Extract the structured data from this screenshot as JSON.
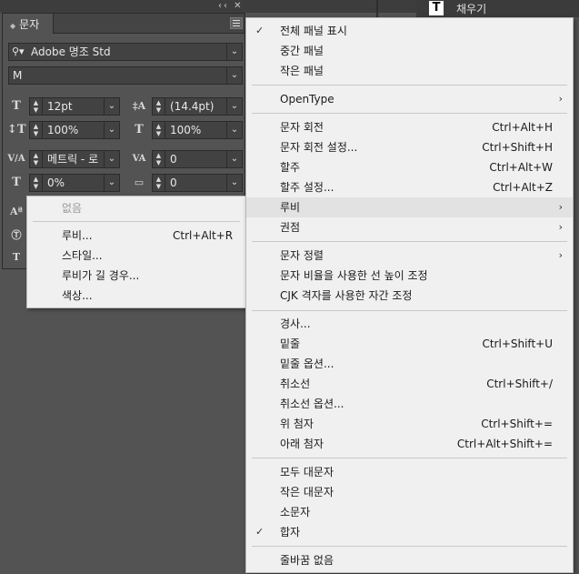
{
  "topbar": {
    "grip": "‹‹ ✕"
  },
  "top_right_panel": {
    "icon_letter": "T",
    "label": "채우기"
  },
  "char_panel": {
    "tab_label": "문자",
    "font_family": "Adobe 명조 Std",
    "font_style": "M",
    "font_size": "12pt",
    "leading": "(14.4pt)",
    "vertical_scale": "100%",
    "horizontal_scale": "100%",
    "kerning": "메트릭 - 로",
    "tracking": "0",
    "tsume": "0%",
    "grid_spacing": "0"
  },
  "ruby_menu": {
    "items": [
      {
        "label": "없음",
        "shortcut": ""
      },
      {
        "label": "루비...",
        "shortcut": "Ctrl+Alt+R"
      },
      {
        "label": "스타일...",
        "shortcut": ""
      },
      {
        "label": "루비가 길 경우...",
        "shortcut": ""
      },
      {
        "label": "색상...",
        "shortcut": ""
      }
    ]
  },
  "main_menu": {
    "items": [
      {
        "label": "전체 패널 표시",
        "shortcut": "",
        "check": "✓"
      },
      {
        "label": "중간 패널",
        "shortcut": "",
        "check": ""
      },
      {
        "label": "작은 패널",
        "shortcut": "",
        "check": ""
      },
      {
        "label": "OpenType",
        "shortcut": "",
        "check": ""
      },
      {
        "label": "문자 회전",
        "shortcut": "Ctrl+Alt+H",
        "check": ""
      },
      {
        "label": "문자 회전 설정...",
        "shortcut": "Ctrl+Shift+H",
        "check": ""
      },
      {
        "label": "할주",
        "shortcut": "Ctrl+Alt+W",
        "check": ""
      },
      {
        "label": "할주 설정...",
        "shortcut": "Ctrl+Alt+Z",
        "check": ""
      },
      {
        "label": "루비",
        "shortcut": "",
        "check": ""
      },
      {
        "label": "권점",
        "shortcut": "",
        "check": ""
      },
      {
        "label": "문자 정렬",
        "shortcut": "",
        "check": ""
      },
      {
        "label": "문자 비율을 사용한 선 높이 조정",
        "shortcut": "",
        "check": ""
      },
      {
        "label": "CJK 격자를 사용한 자간 조정",
        "shortcut": "",
        "check": ""
      },
      {
        "label": "경사...",
        "shortcut": "",
        "check": ""
      },
      {
        "label": "밑줄",
        "shortcut": "Ctrl+Shift+U",
        "check": ""
      },
      {
        "label": "밑줄 옵션...",
        "shortcut": "",
        "check": ""
      },
      {
        "label": "취소선",
        "shortcut": "Ctrl+Shift+/",
        "check": ""
      },
      {
        "label": "취소선 옵션...",
        "shortcut": "",
        "check": ""
      },
      {
        "label": "위 첨자",
        "shortcut": "Ctrl+Shift+=",
        "check": ""
      },
      {
        "label": "아래 첨자",
        "shortcut": "Ctrl+Alt+Shift+=",
        "check": ""
      },
      {
        "label": "모두 대문자",
        "shortcut": "",
        "check": ""
      },
      {
        "label": "작은 대문자",
        "shortcut": "",
        "check": ""
      },
      {
        "label": "소문자",
        "shortcut": "",
        "check": ""
      },
      {
        "label": "합자",
        "shortcut": "",
        "check": "✓"
      },
      {
        "label": "줄바꿈 없음",
        "shortcut": "",
        "check": ""
      }
    ],
    "submenu_arrow": "›"
  }
}
